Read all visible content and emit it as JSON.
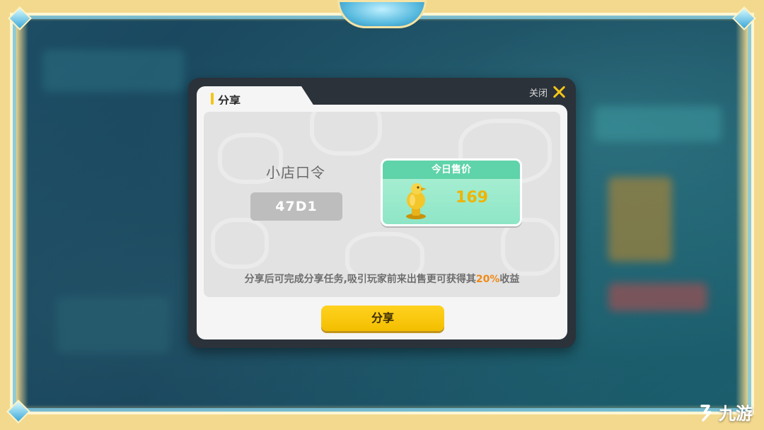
{
  "dialog": {
    "tab_title": "分享",
    "close_label": "关闭",
    "code_title": "小店口令",
    "code_value": "47D1",
    "price_header": "今日售价",
    "price_value": "169",
    "desc_prefix": "分享后可完成分享任务,吸引玩家前来出售更可获得其",
    "desc_highlight": "20%",
    "desc_suffix": "收益",
    "share_button": "分享"
  },
  "watermark": {
    "text": "九游"
  },
  "colors": {
    "accent_yellow": "#f5c518",
    "price_green": "#5fd3a9",
    "highlight_orange": "#f08a18"
  },
  "icons": [
    "close-icon",
    "trophy-icon",
    "logo-icon"
  ]
}
